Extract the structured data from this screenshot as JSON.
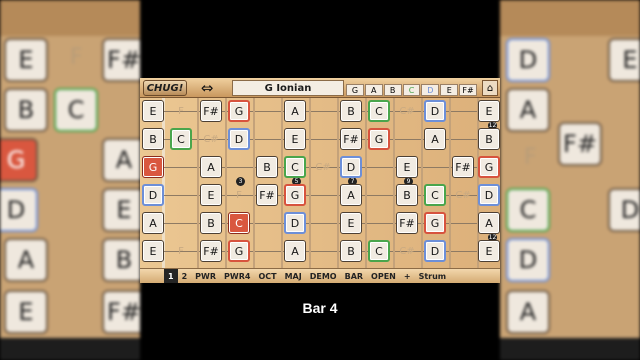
{
  "app": {
    "logo": "CHUG!",
    "swap_icon": "swap-arrows-icon",
    "scale_name": "G Ionian",
    "scale_notes": [
      "G",
      "A",
      "B",
      "C",
      "D",
      "E",
      "F#"
    ],
    "home_icon": "home-icon"
  },
  "bottom_menu": [
    "1",
    "2",
    "PWR",
    "PWR4",
    "OCT",
    "MAJ",
    "DEMO",
    "BAR",
    "OPEN",
    "+",
    "Strum"
  ],
  "fret_markers": [
    "3",
    "5",
    "7",
    "9",
    "12"
  ],
  "caption": "Bar 4"
}
